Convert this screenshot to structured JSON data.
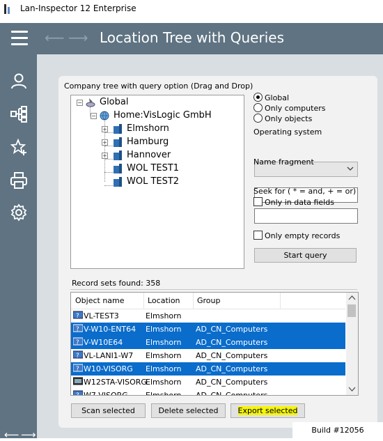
{
  "window": {
    "title": "Lan-Inspector 12 Enterprise"
  },
  "header": {
    "title": "Location Tree with Queries",
    "menu_icon": "hamburger-icon",
    "back_icon": "arrow-left-icon",
    "forward_icon": "arrow-right-icon"
  },
  "sidebar": {
    "items": [
      {
        "icon": "user-icon"
      },
      {
        "icon": "hierarchy-icon"
      },
      {
        "icon": "star-plus-icon"
      },
      {
        "icon": "printer-icon"
      },
      {
        "icon": "gear-icon"
      }
    ]
  },
  "panel": {
    "group_label": "Company tree with query option (Drag and Drop)"
  },
  "tree": {
    "root": "Global",
    "company": "Home:VisLogic GmbH",
    "locations": [
      "Elmshorn",
      "Hamburg",
      "Hannover",
      "WOL TEST1",
      "WOL TEST2"
    ]
  },
  "query": {
    "scope_options": [
      "Global",
      "Only computers",
      "Only objects"
    ],
    "selected_scope": "Global",
    "os_label": "Operating system",
    "os_value": "",
    "name_fragment_label": "Name fragment",
    "name_fragment_value": "",
    "seek_label": "Seek for ( * = and, + = or)",
    "only_data_fields_label": "Only in data fields",
    "seek_value": "",
    "only_empty_label": "Only empty records",
    "start_button": "Start query"
  },
  "records": {
    "found_label": "Record sets found: 358",
    "columns": [
      "Object name",
      "Location",
      "Group"
    ],
    "rows": [
      {
        "name": "VL-TEST3",
        "location": "Elmshorn",
        "group": "",
        "selected": false
      },
      {
        "name": "V-W10-ENT64",
        "location": "Elmshorn",
        "group": "AD_CN_Computers",
        "selected": true
      },
      {
        "name": "V-W10E64",
        "location": "Elmshorn",
        "group": "AD_CN_Computers",
        "selected": true
      },
      {
        "name": "VL-LANI1-W7",
        "location": "Elmshorn",
        "group": "AD_CN_Computers",
        "selected": false
      },
      {
        "name": "W10-VISORG",
        "location": "Elmshorn",
        "group": "AD_CN_Computers",
        "selected": true
      },
      {
        "name": "W12STA-VISORG",
        "location": "Elmshorn",
        "group": "AD_CN_Computers",
        "selected": false
      },
      {
        "name": "W7-VISORG",
        "location": "Elmshorn",
        "group": "AD_CN_Computers",
        "selected": false
      }
    ]
  },
  "actions": {
    "scan": "Scan selected",
    "delete": "Delete selected",
    "export": "Export selected"
  },
  "colors": {
    "header": "#5f7382",
    "selection": "#0a6ccb",
    "highlight": "#f5f50e"
  },
  "footer": {
    "build": "Build #12056"
  }
}
